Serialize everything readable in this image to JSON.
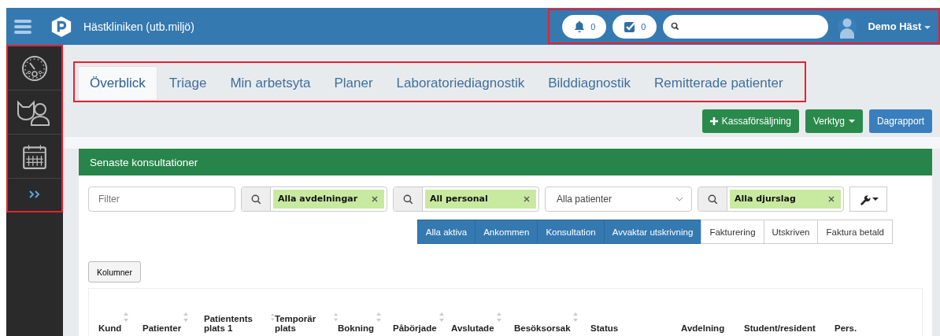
{
  "header": {
    "title": "Hästkliniken (utb.miljö)",
    "notifications": "0",
    "tasks": "0",
    "user": "Demo Häst",
    "highlighted": true
  },
  "sidebar": {
    "highlighted": true,
    "items": [
      {
        "kind": "gauge"
      },
      {
        "kind": "patients"
      },
      {
        "kind": "calendar"
      },
      {
        "kind": "expand"
      }
    ]
  },
  "tabs": {
    "highlighted": true,
    "items": [
      {
        "label": "Överblick",
        "selected": true
      },
      {
        "label": "Triage",
        "selected": false
      },
      {
        "label": "Min arbetsyta",
        "selected": false
      },
      {
        "label": "Planer",
        "selected": false
      },
      {
        "label": "Laboratoriediagnostik",
        "selected": false
      },
      {
        "label": "Bilddiagnostik",
        "selected": false
      },
      {
        "label": "Remitterade patienter",
        "selected": false
      }
    ]
  },
  "actions": [
    {
      "label": "Kassaförsäljning",
      "kind": "add"
    },
    {
      "label": "Verktyg",
      "kind": "dropdown"
    },
    {
      "label": "Dagrapport",
      "kind": "primary"
    }
  ],
  "panel": {
    "title": "Senaste konsultationer",
    "filters": [
      {
        "kind": "text",
        "placeholder": "Filter"
      },
      {
        "kind": "tag",
        "value": "Alla avdelningar"
      },
      {
        "kind": "tag",
        "value": "All personal"
      },
      {
        "kind": "select",
        "value": "Alla patienter"
      },
      {
        "kind": "tag",
        "value": "Alla djurslag"
      },
      {
        "kind": "tool"
      }
    ],
    "status_buttons": [
      {
        "label": "Alla aktiva",
        "selected": true
      },
      {
        "label": "Ankommen",
        "selected": true
      },
      {
        "label": "Konsultation",
        "selected": true
      },
      {
        "label": "Avvaktar utskrivning",
        "selected": true
      },
      {
        "label": "Fakturering",
        "selected": false
      },
      {
        "label": "Utskriven",
        "selected": false
      },
      {
        "label": "Faktura betald",
        "selected": false
      }
    ],
    "columns_button": "Kolumner",
    "table": {
      "columns": [
        {
          "label": "Kund",
          "sortable": true
        },
        {
          "label": "Patienter",
          "sortable": true
        },
        {
          "label": "Patientents plats 1",
          "sortable": true
        },
        {
          "label": "Temporär plats",
          "sortable": true
        },
        {
          "label": "Bokning",
          "sortable": true
        },
        {
          "label": "Påbörjade",
          "sortable": true
        },
        {
          "label": "Avslutade",
          "sortable": true
        },
        {
          "label": "Besöksorsak",
          "sortable": true
        },
        {
          "label": "Status",
          "sortable": false
        },
        {
          "label": "Avdelning",
          "sortable": false
        },
        {
          "label": "Student/resident",
          "sortable": false
        },
        {
          "label": "Pers.",
          "sortable": false
        }
      ]
    }
  }
}
